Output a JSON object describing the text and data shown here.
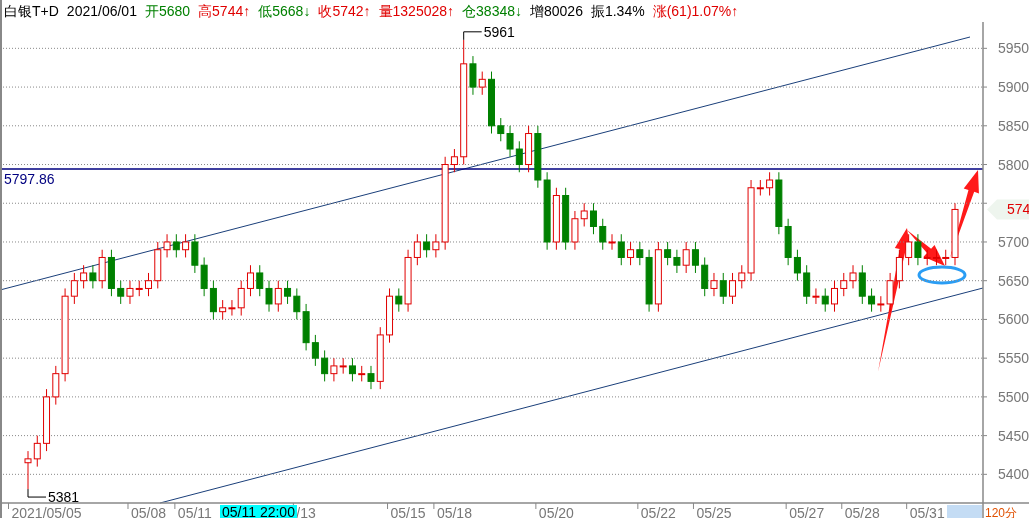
{
  "header": [
    {
      "text": "白银T+D",
      "color": "#000000"
    },
    {
      "text": "2021/06/01",
      "color": "#000000"
    },
    {
      "text": "开5680",
      "color": "#008000"
    },
    {
      "text": "高5744↑",
      "color": "#e00000"
    },
    {
      "text": "低5668↓",
      "color": "#008000"
    },
    {
      "text": "收5742↑",
      "color": "#e00000"
    },
    {
      "text": "量1325028↑",
      "color": "#e00000"
    },
    {
      "text": "仓38348↓",
      "color": "#008000"
    },
    {
      "text": "增80026",
      "color": "#000000"
    },
    {
      "text": "振1.34%",
      "color": "#000000"
    },
    {
      "text": "涨(61)1.07%↑",
      "color": "#e00000"
    }
  ],
  "chart": {
    "chart_data": {
      "type": "candlestick",
      "ylim": [
        5363,
        5984
      ],
      "yticks": [
        5400,
        5450,
        5500,
        5550,
        5600,
        5650,
        5700,
        5800,
        5850,
        5900,
        5950
      ],
      "grid": true,
      "categories": [
        null,
        null,
        "2021/05/05",
        null,
        null,
        null,
        null,
        null,
        null,
        null,
        null,
        null,
        null,
        "05/08",
        null,
        null,
        null,
        null,
        "05/11",
        null,
        null,
        null,
        null,
        null,
        null,
        null,
        null,
        null,
        null,
        null,
        "/13",
        null,
        null,
        null,
        null,
        null,
        null,
        null,
        null,
        null,
        null,
        "05/15",
        null,
        null,
        null,
        null,
        "05/18",
        null,
        null,
        null,
        null,
        null,
        null,
        null,
        null,
        null,
        null,
        "05/20",
        null,
        null,
        null,
        null,
        null,
        null,
        null,
        null,
        null,
        null,
        "05/22",
        null,
        null,
        null,
        null,
        null,
        "05/25",
        null,
        null,
        null,
        null,
        null,
        null,
        null,
        null,
        null,
        "05/27",
        null,
        null,
        null,
        null,
        null,
        "05/28",
        null,
        null,
        null,
        null,
        null,
        null,
        "05/31",
        null,
        null,
        null
      ],
      "ohlc": [
        [
          5415,
          5430,
          5381,
          5420
        ],
        [
          5420,
          5450,
          5410,
          5440
        ],
        [
          5440,
          5510,
          5430,
          5500
        ],
        [
          5500,
          5540,
          5490,
          5530
        ],
        [
          5530,
          5640,
          5520,
          5630
        ],
        [
          5630,
          5660,
          5620,
          5650
        ],
        [
          5650,
          5670,
          5640,
          5660
        ],
        [
          5660,
          5670,
          5640,
          5650
        ],
        [
          5650,
          5690,
          5640,
          5680
        ],
        [
          5680,
          5690,
          5630,
          5640
        ],
        [
          5640,
          5650,
          5620,
          5630
        ],
        [
          5630,
          5650,
          5620,
          5640
        ],
        [
          5640,
          5650,
          5630,
          5640
        ],
        [
          5640,
          5660,
          5630,
          5650
        ],
        [
          5650,
          5700,
          5640,
          5690
        ],
        [
          5690,
          5710,
          5680,
          5700
        ],
        [
          5700,
          5710,
          5680,
          5690
        ],
        [
          5690,
          5710,
          5680,
          5700
        ],
        [
          5700,
          5710,
          5660,
          5670
        ],
        [
          5670,
          5680,
          5630,
          5640
        ],
        [
          5640,
          5650,
          5600,
          5610
        ],
        [
          5610,
          5625,
          5600,
          5615
        ],
        [
          5615,
          5625,
          5605,
          5615
        ],
        [
          5615,
          5650,
          5605,
          5640
        ],
        [
          5640,
          5670,
          5630,
          5660
        ],
        [
          5660,
          5670,
          5630,
          5640
        ],
        [
          5640,
          5650,
          5610,
          5620
        ],
        [
          5620,
          5650,
          5610,
          5640
        ],
        [
          5640,
          5650,
          5620,
          5630
        ],
        [
          5630,
          5640,
          5600,
          5610
        ],
        [
          5610,
          5620,
          5560,
          5570
        ],
        [
          5570,
          5580,
          5540,
          5550
        ],
        [
          5550,
          5560,
          5520,
          5530
        ],
        [
          5530,
          5550,
          5520,
          5540
        ],
        [
          5540,
          5550,
          5530,
          5540
        ],
        [
          5540,
          5550,
          5520,
          5530
        ],
        [
          5530,
          5540,
          5520,
          5530
        ],
        [
          5530,
          5540,
          5510,
          5520
        ],
        [
          5520,
          5590,
          5510,
          5580
        ],
        [
          5580,
          5640,
          5570,
          5630
        ],
        [
          5630,
          5640,
          5610,
          5620
        ],
        [
          5620,
          5690,
          5610,
          5680
        ],
        [
          5680,
          5710,
          5670,
          5700
        ],
        [
          5700,
          5710,
          5680,
          5690
        ],
        [
          5690,
          5710,
          5680,
          5700
        ],
        [
          5700,
          5810,
          5690,
          5800
        ],
        [
          5800,
          5820,
          5790,
          5810
        ],
        [
          5810,
          5961,
          5800,
          5930
        ],
        [
          5930,
          5940,
          5890,
          5900
        ],
        [
          5900,
          5920,
          5890,
          5910
        ],
        [
          5910,
          5920,
          5840,
          5850
        ],
        [
          5850,
          5860,
          5830,
          5840
        ],
        [
          5840,
          5850,
          5810,
          5820
        ],
        [
          5820,
          5830,
          5790,
          5800
        ],
        [
          5800,
          5850,
          5790,
          5840
        ],
        [
          5840,
          5850,
          5770,
          5780
        ],
        [
          5780,
          5790,
          5690,
          5700
        ],
        [
          5700,
          5770,
          5690,
          5760
        ],
        [
          5760,
          5770,
          5690,
          5700
        ],
        [
          5700,
          5740,
          5690,
          5730
        ],
        [
          5730,
          5750,
          5720,
          5740
        ],
        [
          5740,
          5750,
          5710,
          5720
        ],
        [
          5720,
          5730,
          5690,
          5700
        ],
        [
          5700,
          5710,
          5690,
          5700
        ],
        [
          5700,
          5710,
          5670,
          5680
        ],
        [
          5680,
          5700,
          5670,
          5690
        ],
        [
          5690,
          5700,
          5670,
          5680
        ],
        [
          5680,
          5690,
          5610,
          5620
        ],
        [
          5620,
          5700,
          5610,
          5690
        ],
        [
          5690,
          5700,
          5670,
          5680
        ],
        [
          5680,
          5690,
          5660,
          5670
        ],
        [
          5670,
          5700,
          5660,
          5690
        ],
        [
          5690,
          5700,
          5660,
          5670
        ],
        [
          5670,
          5680,
          5630,
          5640
        ],
        [
          5640,
          5660,
          5630,
          5650
        ],
        [
          5650,
          5660,
          5620,
          5630
        ],
        [
          5630,
          5660,
          5620,
          5650
        ],
        [
          5650,
          5670,
          5640,
          5660
        ],
        [
          5660,
          5780,
          5650,
          5770
        ],
        [
          5770,
          5780,
          5760,
          5770
        ],
        [
          5770,
          5790,
          5760,
          5780
        ],
        [
          5780,
          5790,
          5710,
          5720
        ],
        [
          5720,
          5730,
          5670,
          5680
        ],
        [
          5680,
          5690,
          5650,
          5660
        ],
        [
          5660,
          5670,
          5620,
          5630
        ],
        [
          5630,
          5640,
          5620,
          5630
        ],
        [
          5630,
          5640,
          5610,
          5620
        ],
        [
          5620,
          5650,
          5610,
          5640
        ],
        [
          5640,
          5660,
          5630,
          5650
        ],
        [
          5650,
          5670,
          5640,
          5660
        ],
        [
          5660,
          5670,
          5620,
          5630
        ],
        [
          5630,
          5640,
          5610,
          5620
        ],
        [
          5620,
          5630,
          5610,
          5620
        ],
        [
          5620,
          5660,
          5610,
          5650
        ],
        [
          5650,
          5690,
          5640,
          5680
        ],
        [
          5680,
          5710,
          5670,
          5700
        ],
        [
          5700,
          5710,
          5670,
          5680
        ],
        [
          5680,
          5690,
          5670,
          5680
        ],
        [
          5680,
          5690,
          5670,
          5680
        ],
        [
          5680,
          5690,
          5670,
          5680
        ],
        [
          5680,
          5750,
          5670,
          5742
        ]
      ],
      "annotations": [
        "5961",
        "5381"
      ]
    },
    "price_line_label": "5797.86",
    "cursor_time": "05/11 22:00",
    "price_tag": "574",
    "period": "120分"
  }
}
